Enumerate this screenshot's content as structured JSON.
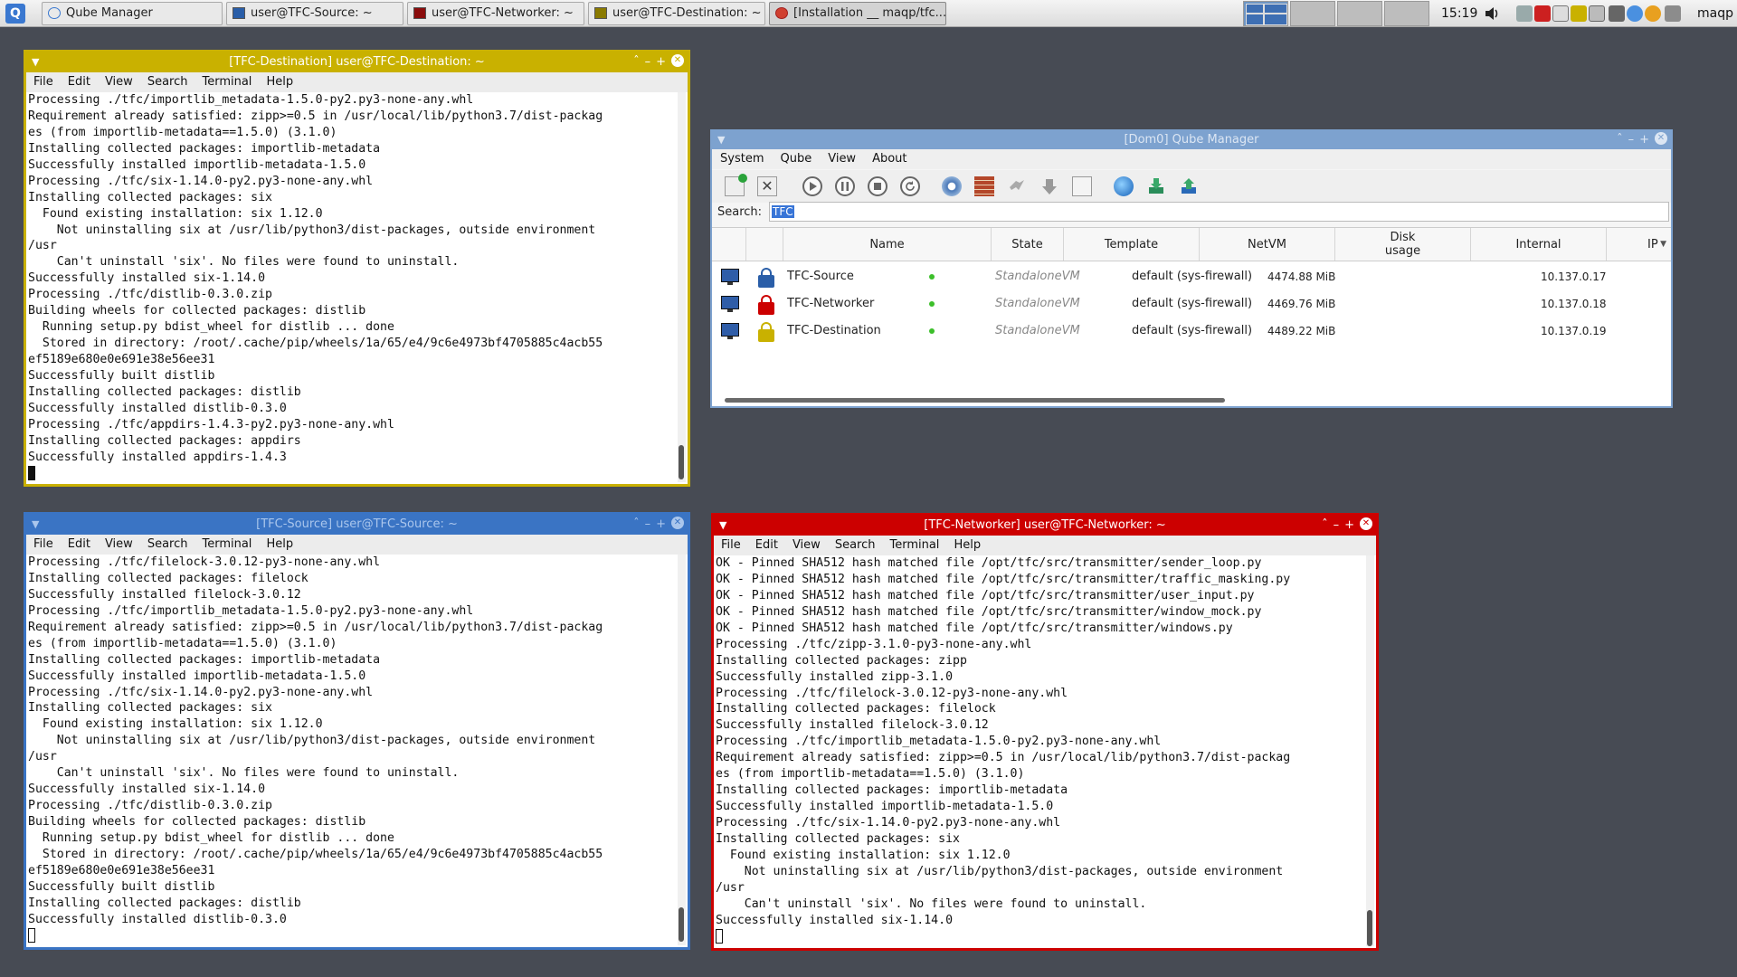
{
  "taskbar": {
    "tasks": [
      {
        "label": "Qube Manager"
      },
      {
        "label": "user@TFC-Source: ~"
      },
      {
        "label": "user@TFC-Networker: ~"
      },
      {
        "label": "user@TFC-Destination: ~"
      },
      {
        "label": "[Installation __ maqp/tfc..."
      }
    ],
    "clock": "15:19",
    "username": "maqp"
  },
  "windows": {
    "destination": {
      "title": "[TFC-Destination] user@TFC-Destination: ~",
      "accent_color": "#c9b100",
      "menu": [
        "File",
        "Edit",
        "View",
        "Search",
        "Terminal",
        "Help"
      ],
      "lines": [
        "Processing ./tfc/importlib_metadata-1.5.0-py2.py3-none-any.whl",
        "Requirement already satisfied: zipp>=0.5 in /usr/local/lib/python3.7/dist-packag",
        "es (from importlib-metadata==1.5.0) (3.1.0)",
        "Installing collected packages: importlib-metadata",
        "Successfully installed importlib-metadata-1.5.0",
        "Processing ./tfc/six-1.14.0-py2.py3-none-any.whl",
        "Installing collected packages: six",
        "  Found existing installation: six 1.12.0",
        "    Not uninstalling six at /usr/lib/python3/dist-packages, outside environment",
        "/usr",
        "    Can't uninstall 'six'. No files were found to uninstall.",
        "Successfully installed six-1.14.0",
        "Processing ./tfc/distlib-0.3.0.zip",
        "Building wheels for collected packages: distlib",
        "  Running setup.py bdist_wheel for distlib ... done",
        "  Stored in directory: /root/.cache/pip/wheels/1a/65/e4/9c6e4973bf4705885c4acb55",
        "ef5189e680e0e691e38e56ee31",
        "Successfully built distlib",
        "Installing collected packages: distlib",
        "Successfully installed distlib-0.3.0",
        "Processing ./tfc/appdirs-1.4.3-py2.py3-none-any.whl",
        "Installing collected packages: appdirs",
        "Successfully installed appdirs-1.4.3"
      ]
    },
    "source": {
      "title": "[TFC-Source] user@TFC-Source: ~",
      "accent_color": "#3a74c4",
      "menu": [
        "File",
        "Edit",
        "View",
        "Search",
        "Terminal",
        "Help"
      ],
      "lines": [
        "Processing ./tfc/filelock-3.0.12-py3-none-any.whl",
        "Installing collected packages: filelock",
        "Successfully installed filelock-3.0.12",
        "Processing ./tfc/importlib_metadata-1.5.0-py2.py3-none-any.whl",
        "Requirement already satisfied: zipp>=0.5 in /usr/local/lib/python3.7/dist-packag",
        "es (from importlib-metadata==1.5.0) (3.1.0)",
        "Installing collected packages: importlib-metadata",
        "Successfully installed importlib-metadata-1.5.0",
        "Processing ./tfc/six-1.14.0-py2.py3-none-any.whl",
        "Installing collected packages: six",
        "  Found existing installation: six 1.12.0",
        "    Not uninstalling six at /usr/lib/python3/dist-packages, outside environment",
        "/usr",
        "    Can't uninstall 'six'. No files were found to uninstall.",
        "Successfully installed six-1.14.0",
        "Processing ./tfc/distlib-0.3.0.zip",
        "Building wheels for collected packages: distlib",
        "  Running setup.py bdist_wheel for distlib ... done",
        "  Stored in directory: /root/.cache/pip/wheels/1a/65/e4/9c6e4973bf4705885c4acb55",
        "ef5189e680e0e691e38e56ee31",
        "Successfully built distlib",
        "Installing collected packages: distlib",
        "Successfully installed distlib-0.3.0"
      ]
    },
    "networker": {
      "title": "[TFC-Networker] user@TFC-Networker: ~",
      "accent_color": "#cc0000",
      "menu": [
        "File",
        "Edit",
        "View",
        "Search",
        "Terminal",
        "Help"
      ],
      "lines": [
        "OK - Pinned SHA512 hash matched file /opt/tfc/src/transmitter/sender_loop.py",
        "OK - Pinned SHA512 hash matched file /opt/tfc/src/transmitter/traffic_masking.py",
        "OK - Pinned SHA512 hash matched file /opt/tfc/src/transmitter/user_input.py",
        "OK - Pinned SHA512 hash matched file /opt/tfc/src/transmitter/window_mock.py",
        "OK - Pinned SHA512 hash matched file /opt/tfc/src/transmitter/windows.py",
        "Processing ./tfc/zipp-3.1.0-py3-none-any.whl",
        "Installing collected packages: zipp",
        "Successfully installed zipp-3.1.0",
        "Processing ./tfc/filelock-3.0.12-py3-none-any.whl",
        "Installing collected packages: filelock",
        "Successfully installed filelock-3.0.12",
        "Processing ./tfc/importlib_metadata-1.5.0-py2.py3-none-any.whl",
        "Requirement already satisfied: zipp>=0.5 in /usr/local/lib/python3.7/dist-packag",
        "es (from importlib-metadata==1.5.0) (3.1.0)",
        "Installing collected packages: importlib-metadata",
        "Successfully installed importlib-metadata-1.5.0",
        "Processing ./tfc/six-1.14.0-py2.py3-none-any.whl",
        "Installing collected packages: six",
        "  Found existing installation: six 1.12.0",
        "    Not uninstalling six at /usr/lib/python3/dist-packages, outside environment",
        "/usr",
        "    Can't uninstall 'six'. No files were found to uninstall.",
        "Successfully installed six-1.14.0"
      ]
    },
    "qube_manager": {
      "title": "[Dom0] Qube Manager",
      "accent_color": "#7da2cf",
      "menu": [
        "System",
        "Qube",
        "View",
        "About"
      ],
      "search_label": "Search:",
      "search_value": "TFC",
      "columns": [
        "Name",
        "State",
        "Template",
        "NetVM",
        "Disk usage",
        "Internal",
        "IP"
      ],
      "rows": [
        {
          "name": "TFC-Source",
          "state": "running",
          "template": "StandaloneVM",
          "netvm": "default (sys-firewall)",
          "disk": "4474.88 MiB",
          "internal": "",
          "ip": "10.137.0.17",
          "label_color": "#2a5ea8"
        },
        {
          "name": "TFC-Networker",
          "state": "running",
          "template": "StandaloneVM",
          "netvm": "default (sys-firewall)",
          "disk": "4469.76 MiB",
          "internal": "",
          "ip": "10.137.0.18",
          "label_color": "#cc0000"
        },
        {
          "name": "TFC-Destination",
          "state": "running",
          "template": "StandaloneVM",
          "netvm": "default (sys-firewall)",
          "disk": "4489.22 MiB",
          "internal": "",
          "ip": "10.137.0.19",
          "label_color": "#c9b100"
        }
      ]
    }
  }
}
